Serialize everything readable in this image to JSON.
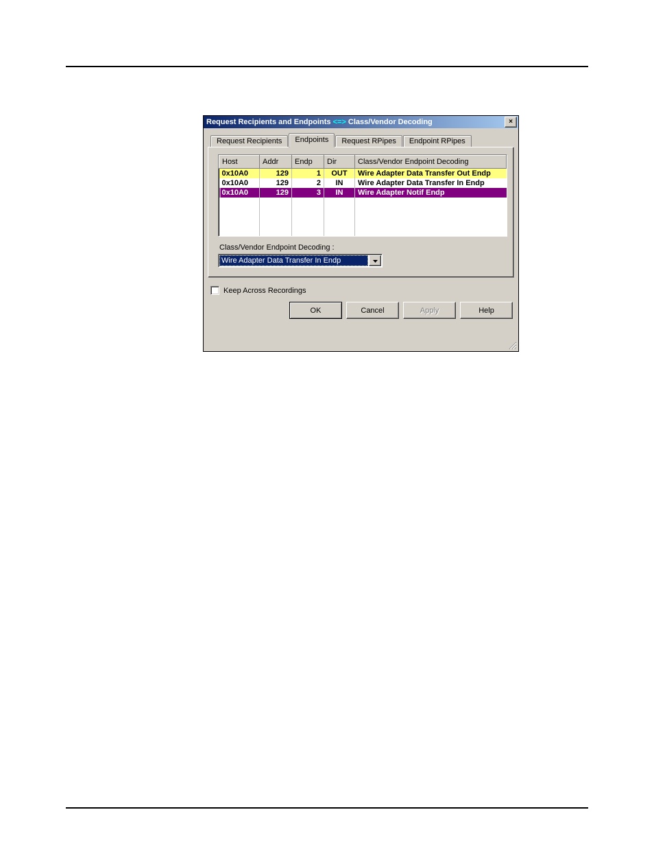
{
  "window": {
    "title_pre": "Request Recipients and Endpoints ",
    "title_mid": "<=>",
    "title_post": " Class/Vendor Decoding",
    "close_label": "×"
  },
  "tabs": [
    {
      "label": "Request Recipients"
    },
    {
      "label": "Endpoints"
    },
    {
      "label": "Request RPipes"
    },
    {
      "label": "Endpoint RPipes"
    }
  ],
  "active_tab_index": 1,
  "table": {
    "headers": {
      "host": "Host",
      "addr": "Addr",
      "endp": "Endp",
      "dir": "Dir",
      "dec": "Class/Vendor Endpoint Decoding"
    },
    "rows": [
      {
        "host": "0x10A0",
        "addr": "129",
        "endp": "1",
        "dir": "OUT",
        "dec": "Wire Adapter Data Transfer Out Endp",
        "style": "yellow"
      },
      {
        "host": "0x10A0",
        "addr": "129",
        "endp": "2",
        "dir": "IN",
        "dec": "Wire Adapter Data Transfer In Endp",
        "style": "white"
      },
      {
        "host": "0x10A0",
        "addr": "129",
        "endp": "3",
        "dir": "IN",
        "dec": "Wire Adapter Notif Endp",
        "style": "purple"
      }
    ],
    "empty_rows": 4
  },
  "decoding": {
    "label": "Class/Vendor Endpoint Decoding :",
    "value": "Wire Adapter Data Transfer In Endp"
  },
  "keep_checkbox": {
    "checked": false,
    "label": "Keep Across Recordings"
  },
  "buttons": {
    "ok": "OK",
    "cancel": "Cancel",
    "apply": "Apply",
    "help": "Help"
  }
}
